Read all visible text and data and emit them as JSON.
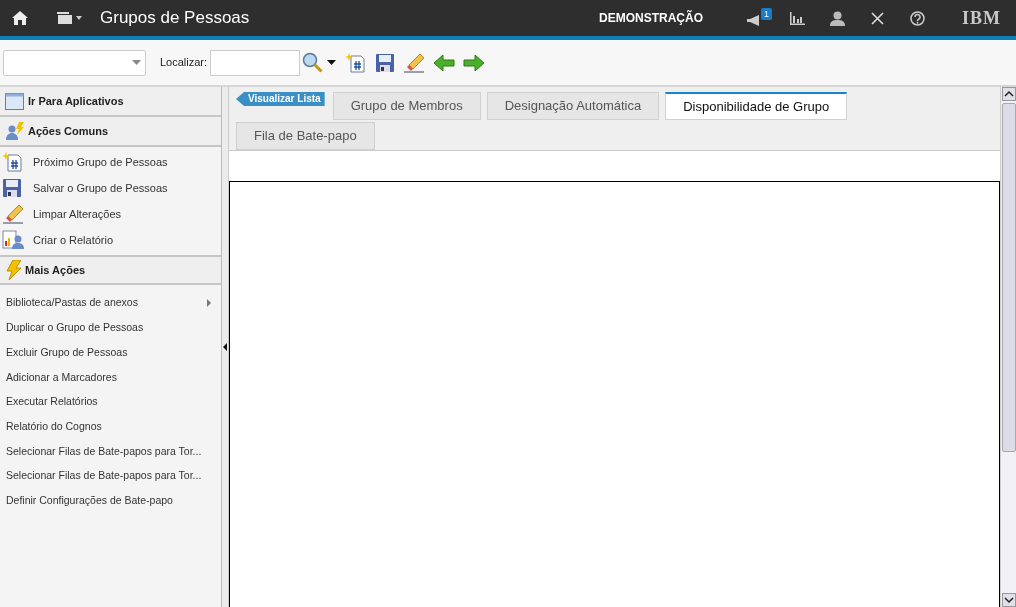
{
  "header": {
    "title": "Grupos de Pessoas",
    "mode": "DEMONSTRAÇÃO",
    "notification_count": "1",
    "logo": "IBM"
  },
  "toolbar": {
    "find_label": "Localizar:"
  },
  "sidebar": {
    "go_to": "Ir Para Aplicativos",
    "common_title": "Ações Comuns",
    "common_actions": [
      {
        "label": "Próximo Grupo de Pessoas"
      },
      {
        "label": "Salvar o Grupo de Pessoas"
      },
      {
        "label": "Limpar Alterações"
      },
      {
        "label": "Criar o Relatório"
      }
    ],
    "more_title": "Mais Ações",
    "more_actions": [
      {
        "label": "Biblioteca/Pastas de anexos",
        "submenu": true
      },
      {
        "label": "Duplicar o Grupo de Pessoas",
        "submenu": false
      },
      {
        "label": "Excluir Grupo de Pessoas",
        "submenu": false
      },
      {
        "label": "Adicionar a Marcadores",
        "submenu": false
      },
      {
        "label": "Executar Relatórios",
        "submenu": false
      },
      {
        "label": "Relatório do Cognos",
        "submenu": false
      },
      {
        "label": "Selecionar Filas de Bate-papos para Tor...",
        "submenu": false
      },
      {
        "label": "Selecionar Filas de Bate-papos para Tor...",
        "submenu": false
      },
      {
        "label": "Definir Configurações de Bate-papo",
        "submenu": false
      }
    ]
  },
  "list_view_button": "Visualizar Lista",
  "tabs": [
    {
      "label": "Grupo de Membros",
      "selected": false
    },
    {
      "label": "Designação Automática",
      "selected": false
    },
    {
      "label": "Disponibilidade de Grupo",
      "selected": true
    },
    {
      "label": "Fila de Bate-papo",
      "selected": false
    }
  ]
}
